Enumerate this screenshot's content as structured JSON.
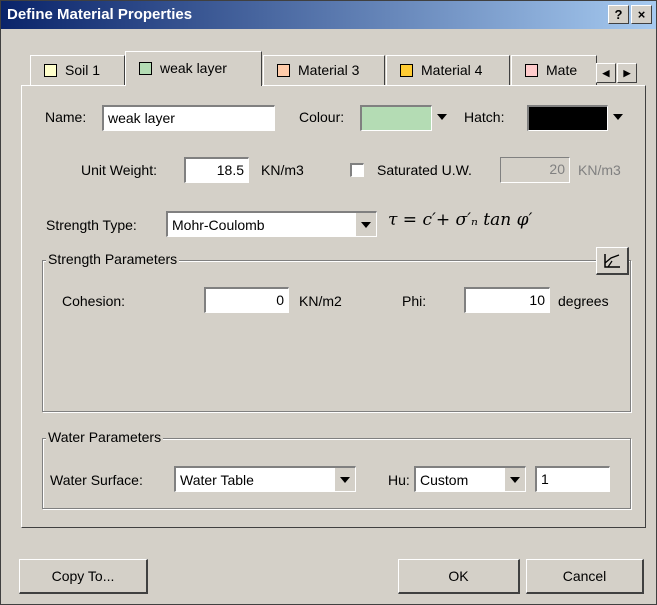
{
  "dialog": {
    "title": "Define Material Properties",
    "help_label": "?",
    "close_label": "×"
  },
  "tabs": [
    {
      "label": "Soil 1",
      "color": "#ffffcc"
    },
    {
      "label": "weak layer",
      "color": "#b4dcb4"
    },
    {
      "label": "Material 3",
      "color": "#ffccaa"
    },
    {
      "label": "Material 4",
      "color": "#ffcc33"
    },
    {
      "label": "Mate",
      "color": "#ffcccc"
    }
  ],
  "tab_scroll": {
    "left": "◀",
    "right": "▶"
  },
  "name": {
    "label": "Name:",
    "value": "weak layer"
  },
  "colour": {
    "label": "Colour:",
    "value": "#b4dcb4"
  },
  "hatch": {
    "label": "Hatch:",
    "value": "#000000"
  },
  "unit_weight": {
    "label": "Unit Weight:",
    "value": "18.5",
    "unit": "KN/m3"
  },
  "saturated": {
    "label": "Saturated U.W.",
    "value": "20",
    "unit": "KN/m3",
    "checked": false
  },
  "strength_type": {
    "label": "Strength Type:",
    "value": "Mohr-Coulomb",
    "formula": "τ = c′+ σ′ₙ tan φ′"
  },
  "strength_params": {
    "title": "Strength Parameters",
    "cohesion_label": "Cohesion:",
    "cohesion_value": "0",
    "cohesion_unit": "KN/m2",
    "phi_label": "Phi:",
    "phi_value": "10",
    "phi_unit": "degrees"
  },
  "water_params": {
    "title": "Water Parameters",
    "surface_label": "Water Surface:",
    "surface_value": "Water Table",
    "hu_label": "Hu:",
    "hu_value": "Custom",
    "hu_input": "1"
  },
  "buttons": {
    "copy_to": "Copy To...",
    "ok": "OK",
    "cancel": "Cancel"
  }
}
